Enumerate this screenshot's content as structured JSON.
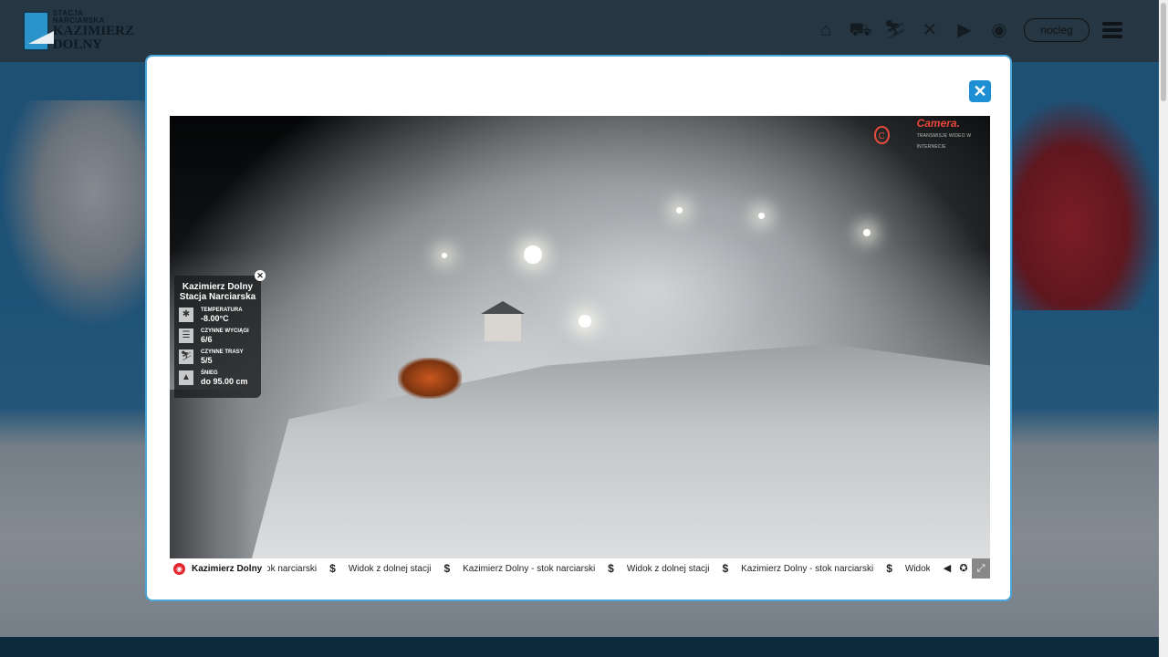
{
  "header": {
    "logo": {
      "line1": "STACJA NARCIARSKA",
      "line2": "KAZIMIERZ",
      "line3": "DOLNY"
    },
    "nav_icons": [
      "lodge-icon",
      "lift-icon",
      "skier-icon",
      "restaurant-icon",
      "video-camera-icon",
      "location-pin-icon"
    ],
    "nocleg_label": "nocleg"
  },
  "modal": {
    "close_glyph": "✕",
    "brand": {
      "name": "Camera.",
      "sub": "TRANSMISJE WIDEO W INTERNECIE"
    },
    "info_panel": {
      "title_line1": "Kazimierz Dolny",
      "title_line2": "Stacja Narciarska",
      "rows": [
        {
          "label": "TEMPERATURA",
          "value": "-8.00°C",
          "icon": "thermometer-icon"
        },
        {
          "label": "CZYNNE WYCIĄGI",
          "value": "6/6",
          "icon": "chairlift-icon"
        },
        {
          "label": "CZYNNE TRASY",
          "value": "5/5",
          "icon": "slope-icon"
        },
        {
          "label": "ŚNIEG",
          "value": "do 95.00 cm",
          "icon": "snow-depth-icon"
        }
      ]
    },
    "ticker": {
      "title": "Kazimierz Dolny",
      "items": [
        "stok narciarski",
        "Widok z dolnej stacji",
        "Kazimierz Dolny - stok narciarski",
        "Widok z dolnej stacji",
        "Kazimierz Dolny - stok narciarski",
        "Widok z dolnej s"
      ]
    }
  },
  "colors": {
    "accent": "#1e8fd4",
    "modal_border": "#4aa6d9",
    "brand_red": "#e8463a",
    "header_bg": "#263642"
  }
}
